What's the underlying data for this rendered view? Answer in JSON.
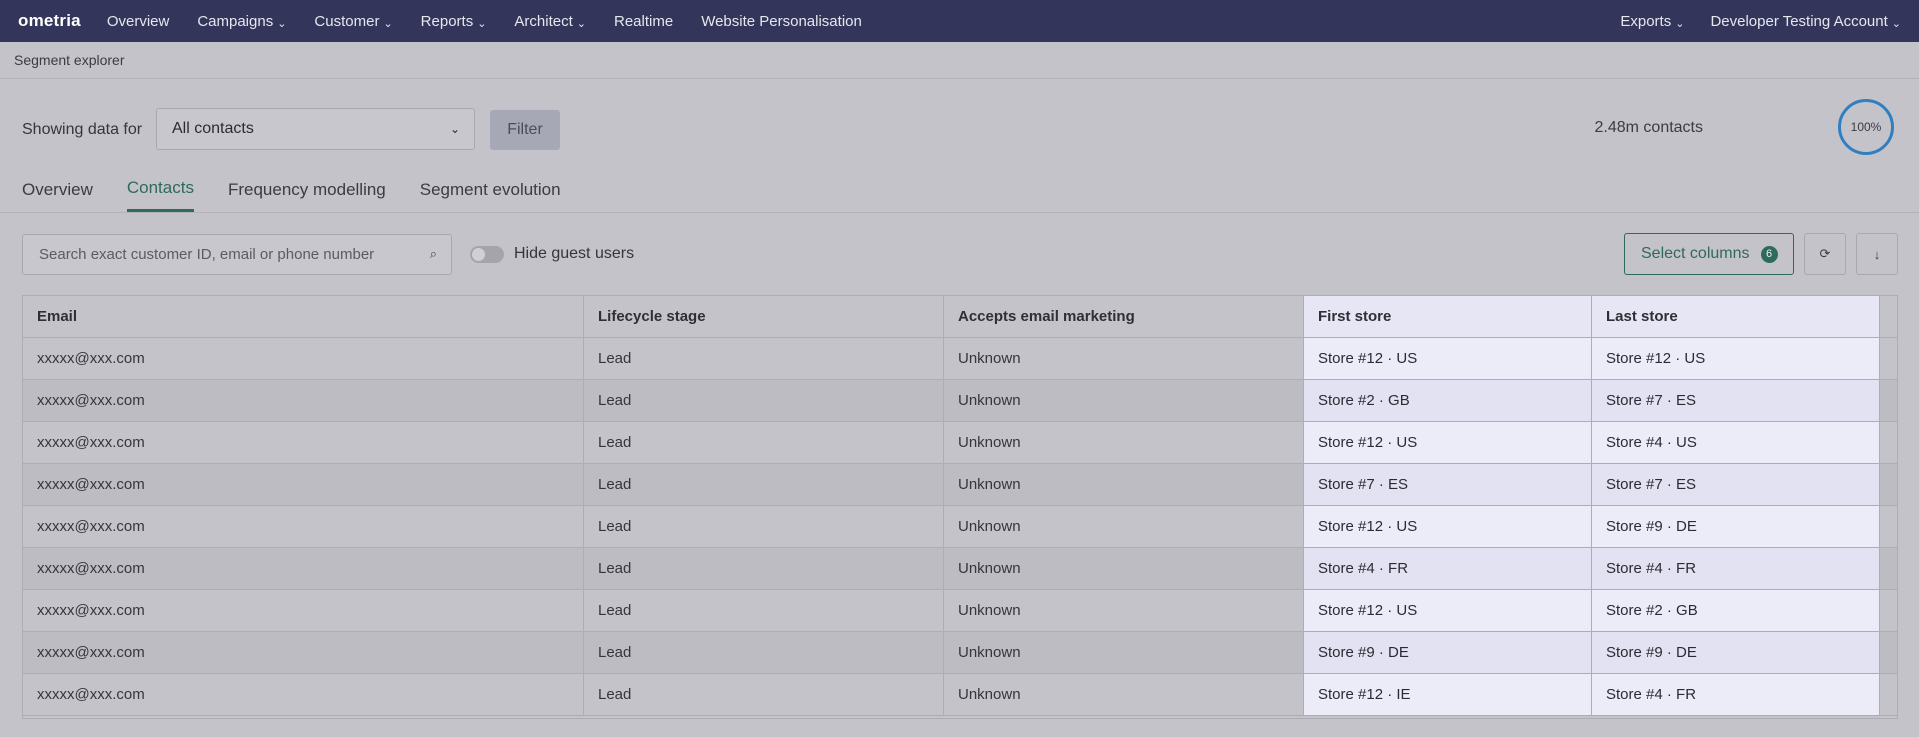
{
  "nav": {
    "logo": "ometria",
    "items": [
      {
        "label": "Overview",
        "dropdown": false
      },
      {
        "label": "Campaigns",
        "dropdown": true
      },
      {
        "label": "Customer",
        "dropdown": true
      },
      {
        "label": "Reports",
        "dropdown": true
      },
      {
        "label": "Architect",
        "dropdown": true
      },
      {
        "label": "Realtime",
        "dropdown": false
      },
      {
        "label": "Website Personalisation",
        "dropdown": false
      }
    ],
    "exports": "Exports",
    "account": "Developer Testing Account",
    "chevron": "⌄"
  },
  "breadcrumb": "Segment explorer",
  "filter": {
    "label": "Showing data for",
    "selected": "All contacts",
    "button": "Filter"
  },
  "summary": {
    "contacts": "2.48m contacts",
    "percent": "100%"
  },
  "tabs": [
    {
      "label": "Overview",
      "active": false
    },
    {
      "label": "Contacts",
      "active": true
    },
    {
      "label": "Frequency modelling",
      "active": false
    },
    {
      "label": "Segment evolution",
      "active": false
    }
  ],
  "toolbar": {
    "search_placeholder": "Search exact customer ID, email or phone number",
    "toggle_label": "Hide guest users",
    "toggle_on": false,
    "select_columns": "Select columns",
    "columns_count": "6"
  },
  "icons": {
    "search": "search-icon",
    "refresh": "refresh-icon",
    "download": "download-icon"
  },
  "table": {
    "headers": [
      "Email",
      "Lifecycle stage",
      "Accepts email marketing",
      "First store",
      "Last store"
    ],
    "rows": [
      [
        "xxxxx@xxx.com",
        "Lead",
        "Unknown",
        "Store #12 · US",
        "Store #12 · US"
      ],
      [
        "xxxxx@xxx.com",
        "Lead",
        "Unknown",
        "Store #2 · GB",
        "Store #7 · ES"
      ],
      [
        "xxxxx@xxx.com",
        "Lead",
        "Unknown",
        "Store #12 · US",
        "Store #4 · US"
      ],
      [
        "xxxxx@xxx.com",
        "Lead",
        "Unknown",
        "Store #7 · ES",
        "Store #7 · ES"
      ],
      [
        "xxxxx@xxx.com",
        "Lead",
        "Unknown",
        "Store #12 · US",
        "Store #9 · DE"
      ],
      [
        "xxxxx@xxx.com",
        "Lead",
        "Unknown",
        "Store #4 · FR",
        "Store #4 · FR"
      ],
      [
        "xxxxx@xxx.com",
        "Lead",
        "Unknown",
        "Store #12 · US",
        "Store #2 · GB"
      ],
      [
        "xxxxx@xxx.com",
        "Lead",
        "Unknown",
        "Store #9 · DE",
        "Store #9 · DE"
      ],
      [
        "xxxxx@xxx.com",
        "Lead",
        "Unknown",
        "Store #12 · IE",
        "Store #4 · FR"
      ]
    ]
  },
  "colors": {
    "nav_bg": "#33365a",
    "accent": "#2e6a5e",
    "ring": "#2f7fc1"
  }
}
